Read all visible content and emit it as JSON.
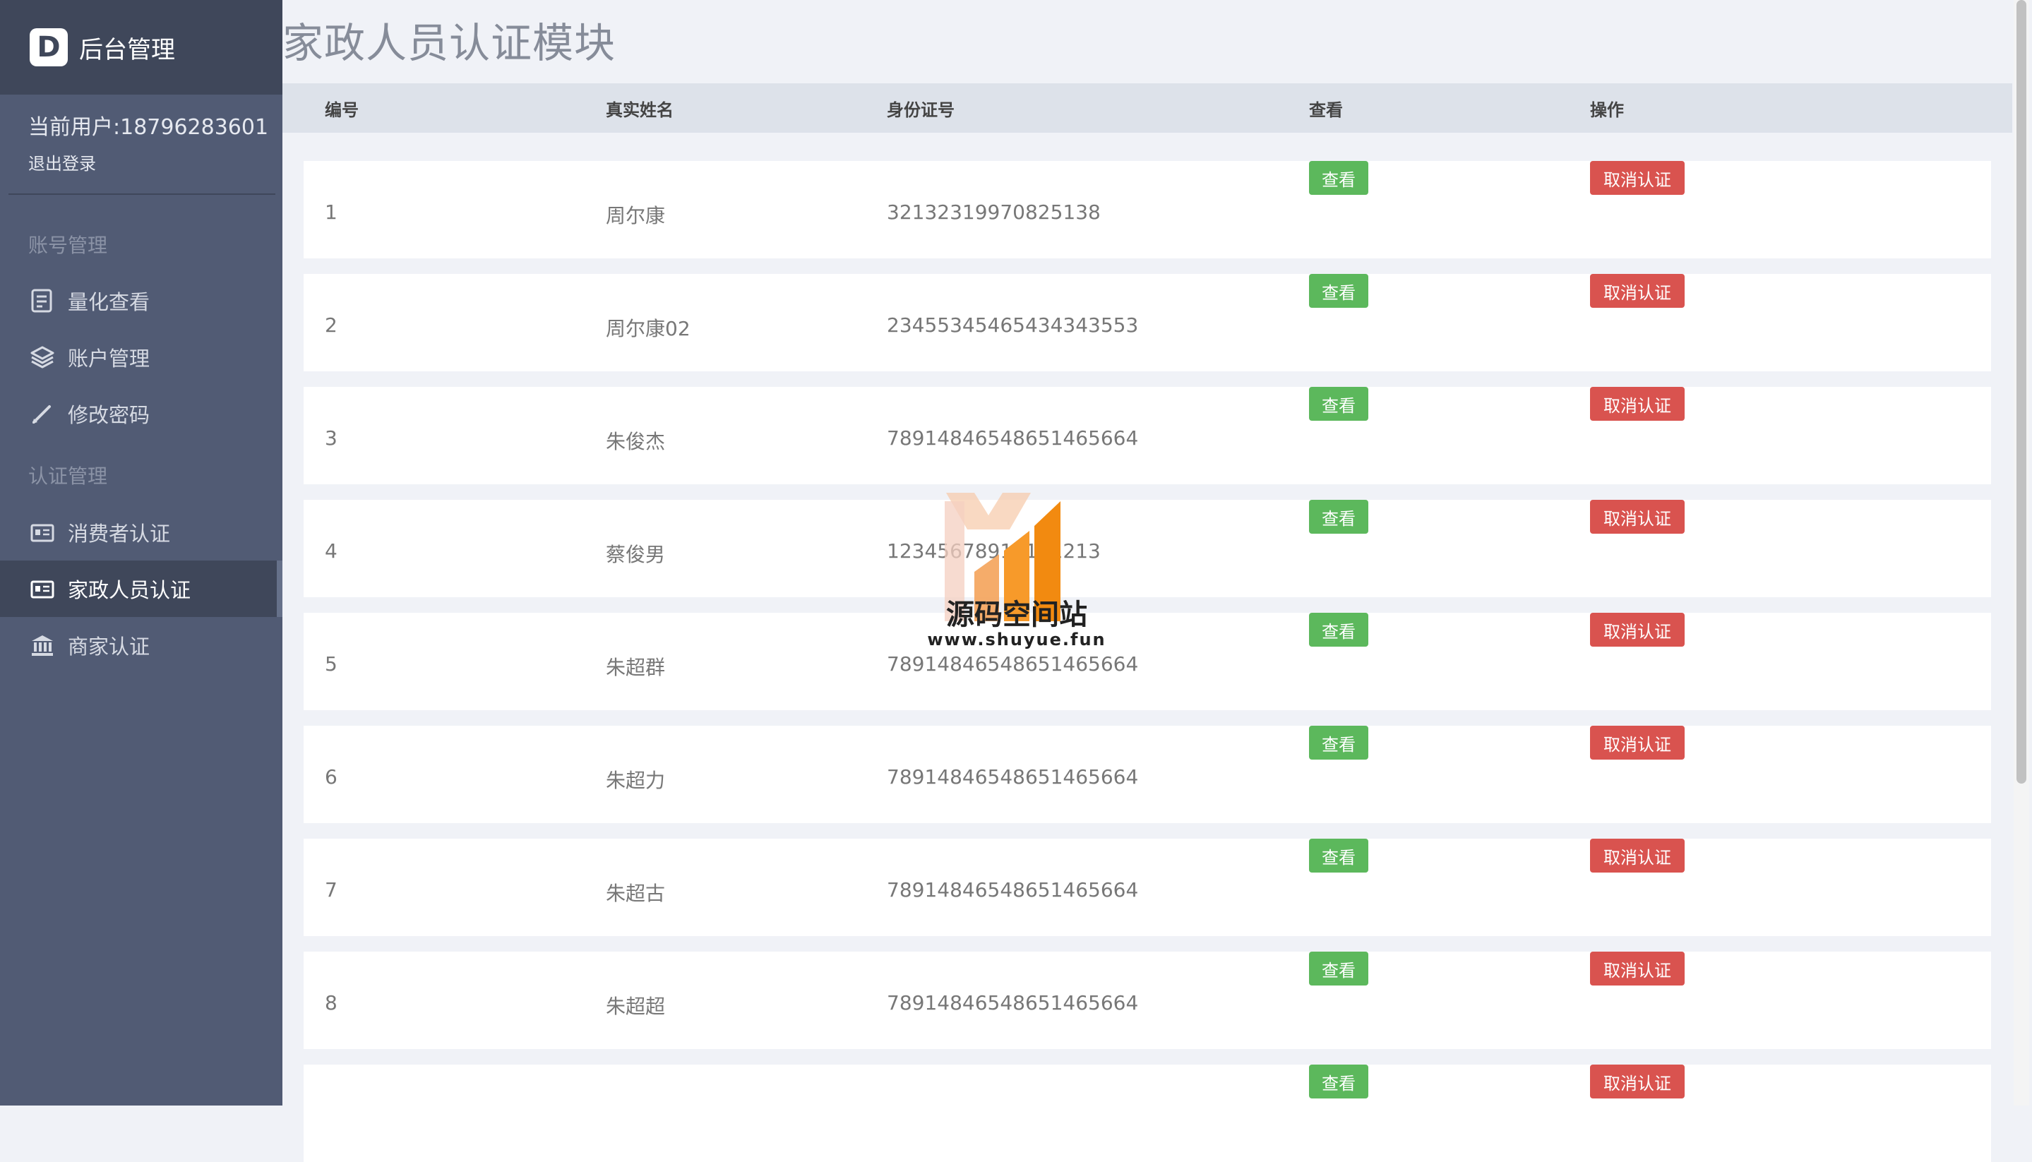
{
  "brand": {
    "logo_letter": "D",
    "title": "后台管理"
  },
  "user": {
    "current": "当前用户:18796283601",
    "logout": "退出登录"
  },
  "nav": {
    "group1_title": "账号管理",
    "group2_title": "认证管理",
    "items": [
      {
        "label": "量化查看",
        "icon": "report-icon"
      },
      {
        "label": "账户管理",
        "icon": "layers-icon"
      },
      {
        "label": "修改密码",
        "icon": "pencil-icon"
      },
      {
        "label": "消费者认证",
        "icon": "id-card-icon"
      },
      {
        "label": "家政人员认证",
        "icon": "id-card-icon",
        "active": true
      },
      {
        "label": "商家认证",
        "icon": "bank-icon"
      }
    ]
  },
  "page": {
    "title": "家政人员认证模块"
  },
  "table": {
    "headers": [
      "编号",
      "真实姓名",
      "身份证号",
      "查看",
      "操作"
    ],
    "view_label": "查看",
    "cancel_label": "取消认证",
    "rows": [
      {
        "id": "1",
        "name": "周尔康",
        "idcard": "32132319970825138"
      },
      {
        "id": "2",
        "name": "周尔康02",
        "idcard": "23455345465434343553"
      },
      {
        "id": "3",
        "name": "朱俊杰",
        "idcard": "78914846548651465664"
      },
      {
        "id": "4",
        "name": "蔡俊男",
        "idcard": "12345678910111213"
      },
      {
        "id": "5",
        "name": "朱超群",
        "idcard": "78914846548651465664"
      },
      {
        "id": "6",
        "name": "朱超力",
        "idcard": "78914846548651465664"
      },
      {
        "id": "7",
        "name": "朱超古",
        "idcard": "78914846548651465664"
      },
      {
        "id": "8",
        "name": "朱超超",
        "idcard": "78914846548651465664"
      },
      {
        "id": "",
        "name": "",
        "idcard": ""
      }
    ]
  },
  "watermark": {
    "text": "源码空间站",
    "url": "www.shuyue.fun"
  },
  "colors": {
    "sidebar": "#515b74",
    "sidebar_dark": "#3f475a",
    "view_button": "#5cb85c",
    "cancel_button": "#d9534f",
    "header_row": "#dde2ea",
    "page_bg": "#f0f2f7"
  }
}
